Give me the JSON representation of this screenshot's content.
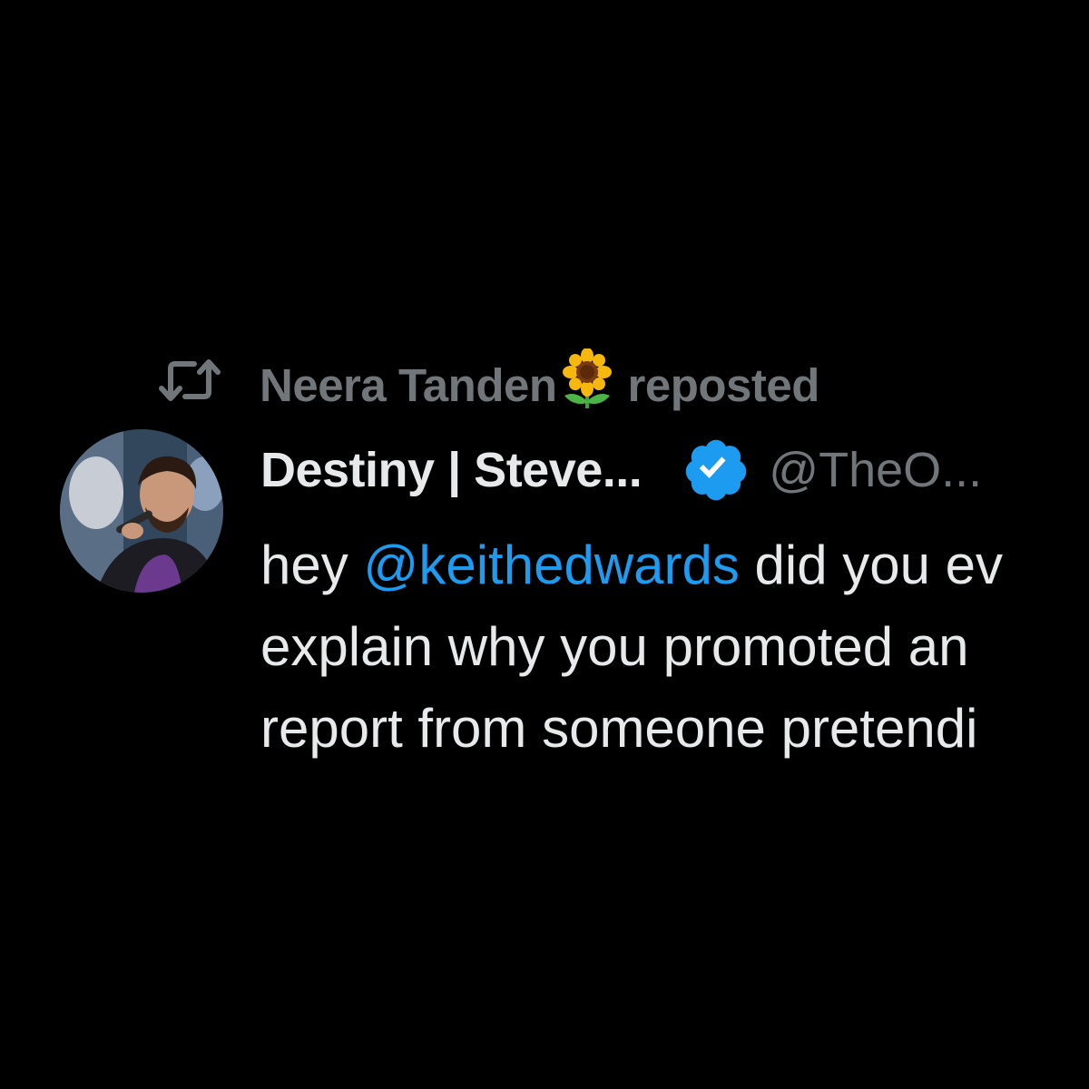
{
  "repost": {
    "icon": "repost-icon",
    "name": "Neera Tanden",
    "emoji_icon": "sunflower-icon",
    "suffix": "reposted"
  },
  "author": {
    "avatar_icon": "avatar",
    "display_name": "Destiny | Steve...",
    "verified_icon": "verified-badge-icon",
    "handle": "@TheO..."
  },
  "tweet": {
    "line1_prefix": "hey ",
    "line1_mention": "@keithedwards",
    "line1_suffix": " did you ev",
    "line2": "explain why you promoted an",
    "line3": "report from someone pretendi"
  },
  "colors": {
    "background": "#000000",
    "primary_text": "#e7e9ea",
    "secondary_text": "#71767b",
    "link": "#1d9bf0",
    "verified": "#1d9bf0"
  }
}
